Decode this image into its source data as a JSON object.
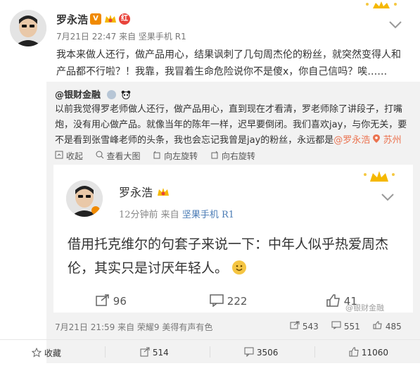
{
  "post": {
    "username": "罗永浩",
    "meta": "7月21日 22:47 来自 坚果手机 R1",
    "body": "我本来做人还行，做产品用心，结果讽刺了几句周杰伦的粉丝，就突然变得人和产品都不行啦？！我靠，我冒着生命危险说你不是傻x，你自己信吗？唉……"
  },
  "repost": {
    "author": "@银财金融",
    "text_part1": "以前我觉得罗老师做人还行，做产品用心，直到现在才看清，罗老师除了讲段子，打嘴炮，没有用心做产品。就像当年的陈年一样，迟早要倒闭。我们喜欢jay，与你无关，要不是看到张雪峰老师的头条，我也会忘记我曾是jay的粉丝，永远都是",
    "mention": "@罗永浩",
    "location": "苏州",
    "actions": [
      "收起",
      "查看大图",
      "向左旋转",
      "向右旋转"
    ],
    "footer_meta": "7月21日 21:59 来自 荣耀9 美得有声有色",
    "stats": {
      "repost": "543",
      "comment": "551",
      "like": "485"
    }
  },
  "shot": {
    "name": "罗永浩",
    "meta_prefix": "12分钟前  来自",
    "meta_source": "坚果手机 R1",
    "body": "借用托克维尔的句套子来说一下：中年人似乎热爱周杰伦，其实只是讨厌年轻人。",
    "repost_count": "96",
    "comment_count": "222",
    "like_count": "41",
    "watermark": "@银财金融"
  },
  "bottom": {
    "fav_label": "收藏",
    "repost_count": "514",
    "comment_count": "3506",
    "like_count": "11060"
  },
  "colors": {
    "accent": "#eb7350",
    "link": "#4a7bb5",
    "crown": "#f5b800"
  },
  "icons": [
    "crown-icon",
    "chevron-down-icon",
    "verified-v-icon",
    "vip-icon",
    "share-icon",
    "comment-icon",
    "like-icon",
    "star-icon",
    "zoom-icon",
    "rotate-left-icon",
    "rotate-right-icon",
    "location-icon",
    "smile-icon"
  ]
}
